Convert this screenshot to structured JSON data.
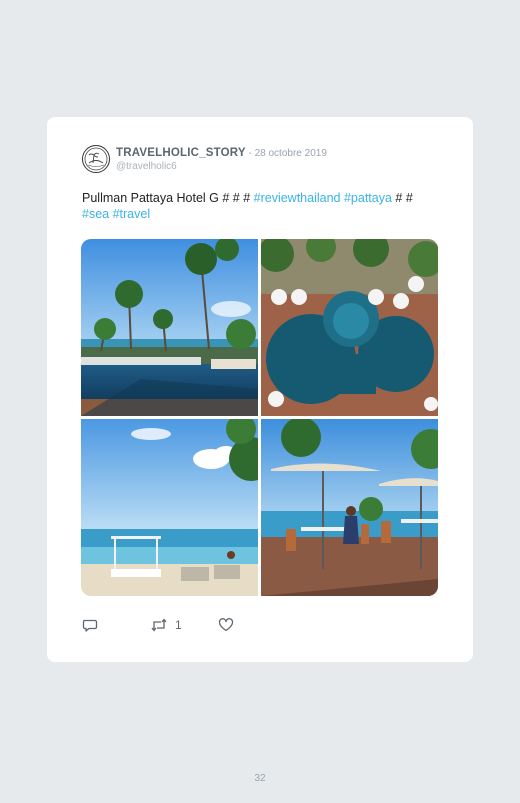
{
  "tweet": {
    "author_name": "TRAVELHOLIC_STORY",
    "separator": " - ",
    "date": "28 octobre 2019",
    "handle": "@travelholic6",
    "text_parts": [
      {
        "text": "Pullman Pattaya Hotel G # # # ",
        "tag": false
      },
      {
        "text": "#reviewthailand",
        "tag": true
      },
      {
        "text": " ",
        "tag": false
      },
      {
        "text": "#pattaya",
        "tag": true
      },
      {
        "text": " # # ",
        "tag": false
      },
      {
        "text": "#sea",
        "tag": true
      },
      {
        "text": " ",
        "tag": false
      },
      {
        "text": "#travel",
        "tag": true
      }
    ],
    "photos": [
      {
        "alt": "pool-palms-photo"
      },
      {
        "alt": "aerial-pool-photo"
      },
      {
        "alt": "beach-daybed-photo"
      },
      {
        "alt": "beach-terrace-photo"
      }
    ],
    "retweet_count": "1"
  },
  "icons": {
    "reply": "reply-icon",
    "retweet": "retweet-icon",
    "like": "heart-icon"
  },
  "colors": {
    "hashtag": "#3ab3e6",
    "background": "#e7eaed",
    "card": "#ffffff"
  },
  "page": {
    "number": "32"
  }
}
